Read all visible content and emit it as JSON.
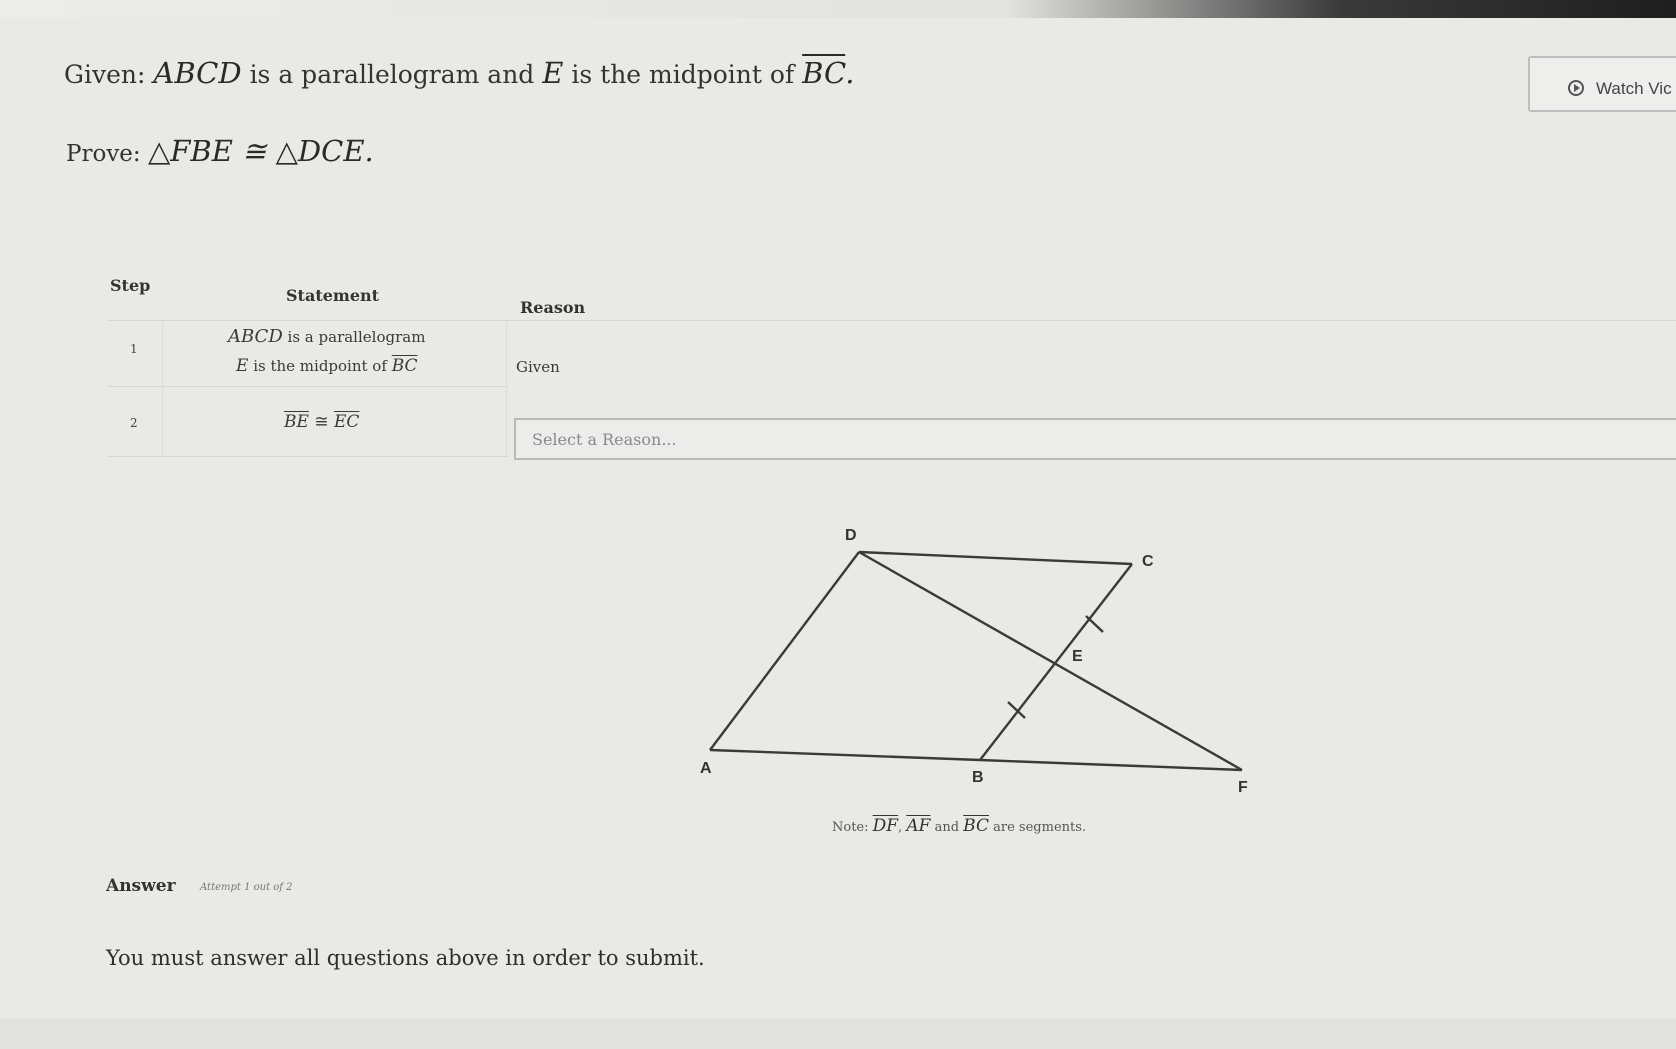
{
  "problem": {
    "given_prefix": "Given:",
    "given_math1": "ABCD",
    "given_text1": "is a parallelogram and",
    "given_math2": "E",
    "given_text2": "is the midpoint of",
    "given_seg": "BC",
    "given_end": ".",
    "prove_prefix": "Prove:",
    "prove_stmt": "△FBE ≅ △DCE."
  },
  "watch_button": {
    "label": "Watch Vic"
  },
  "proof_table": {
    "headers": {
      "step": "Step",
      "statement": "Statement",
      "reason": "Reason"
    },
    "rows": [
      {
        "step": "1",
        "statement_line1_math": "ABCD",
        "statement_line1_text": "is a parallelogram",
        "statement_line2_math": "E",
        "statement_line2_text": "is the midpoint of",
        "statement_line2_seg": "BC",
        "reason": "Given"
      },
      {
        "step": "2",
        "statement_seg1": "BE",
        "statement_op": "≅",
        "statement_seg2": "EC",
        "reason_placeholder": "Select a Reason..."
      }
    ]
  },
  "figure": {
    "labels": {
      "D": "D",
      "C": "C",
      "E": "E",
      "A": "A",
      "B": "B",
      "F": "F"
    },
    "note": {
      "prefix": "Note:",
      "seg1": "DF",
      "comma": ",",
      "seg2": "AF",
      "and": "and",
      "seg3": "BC",
      "suffix": "are segments."
    }
  },
  "answer": {
    "label": "Answer",
    "attempt": "Attempt 1 out of 2",
    "message": "You must answer all questions above in order to submit."
  }
}
